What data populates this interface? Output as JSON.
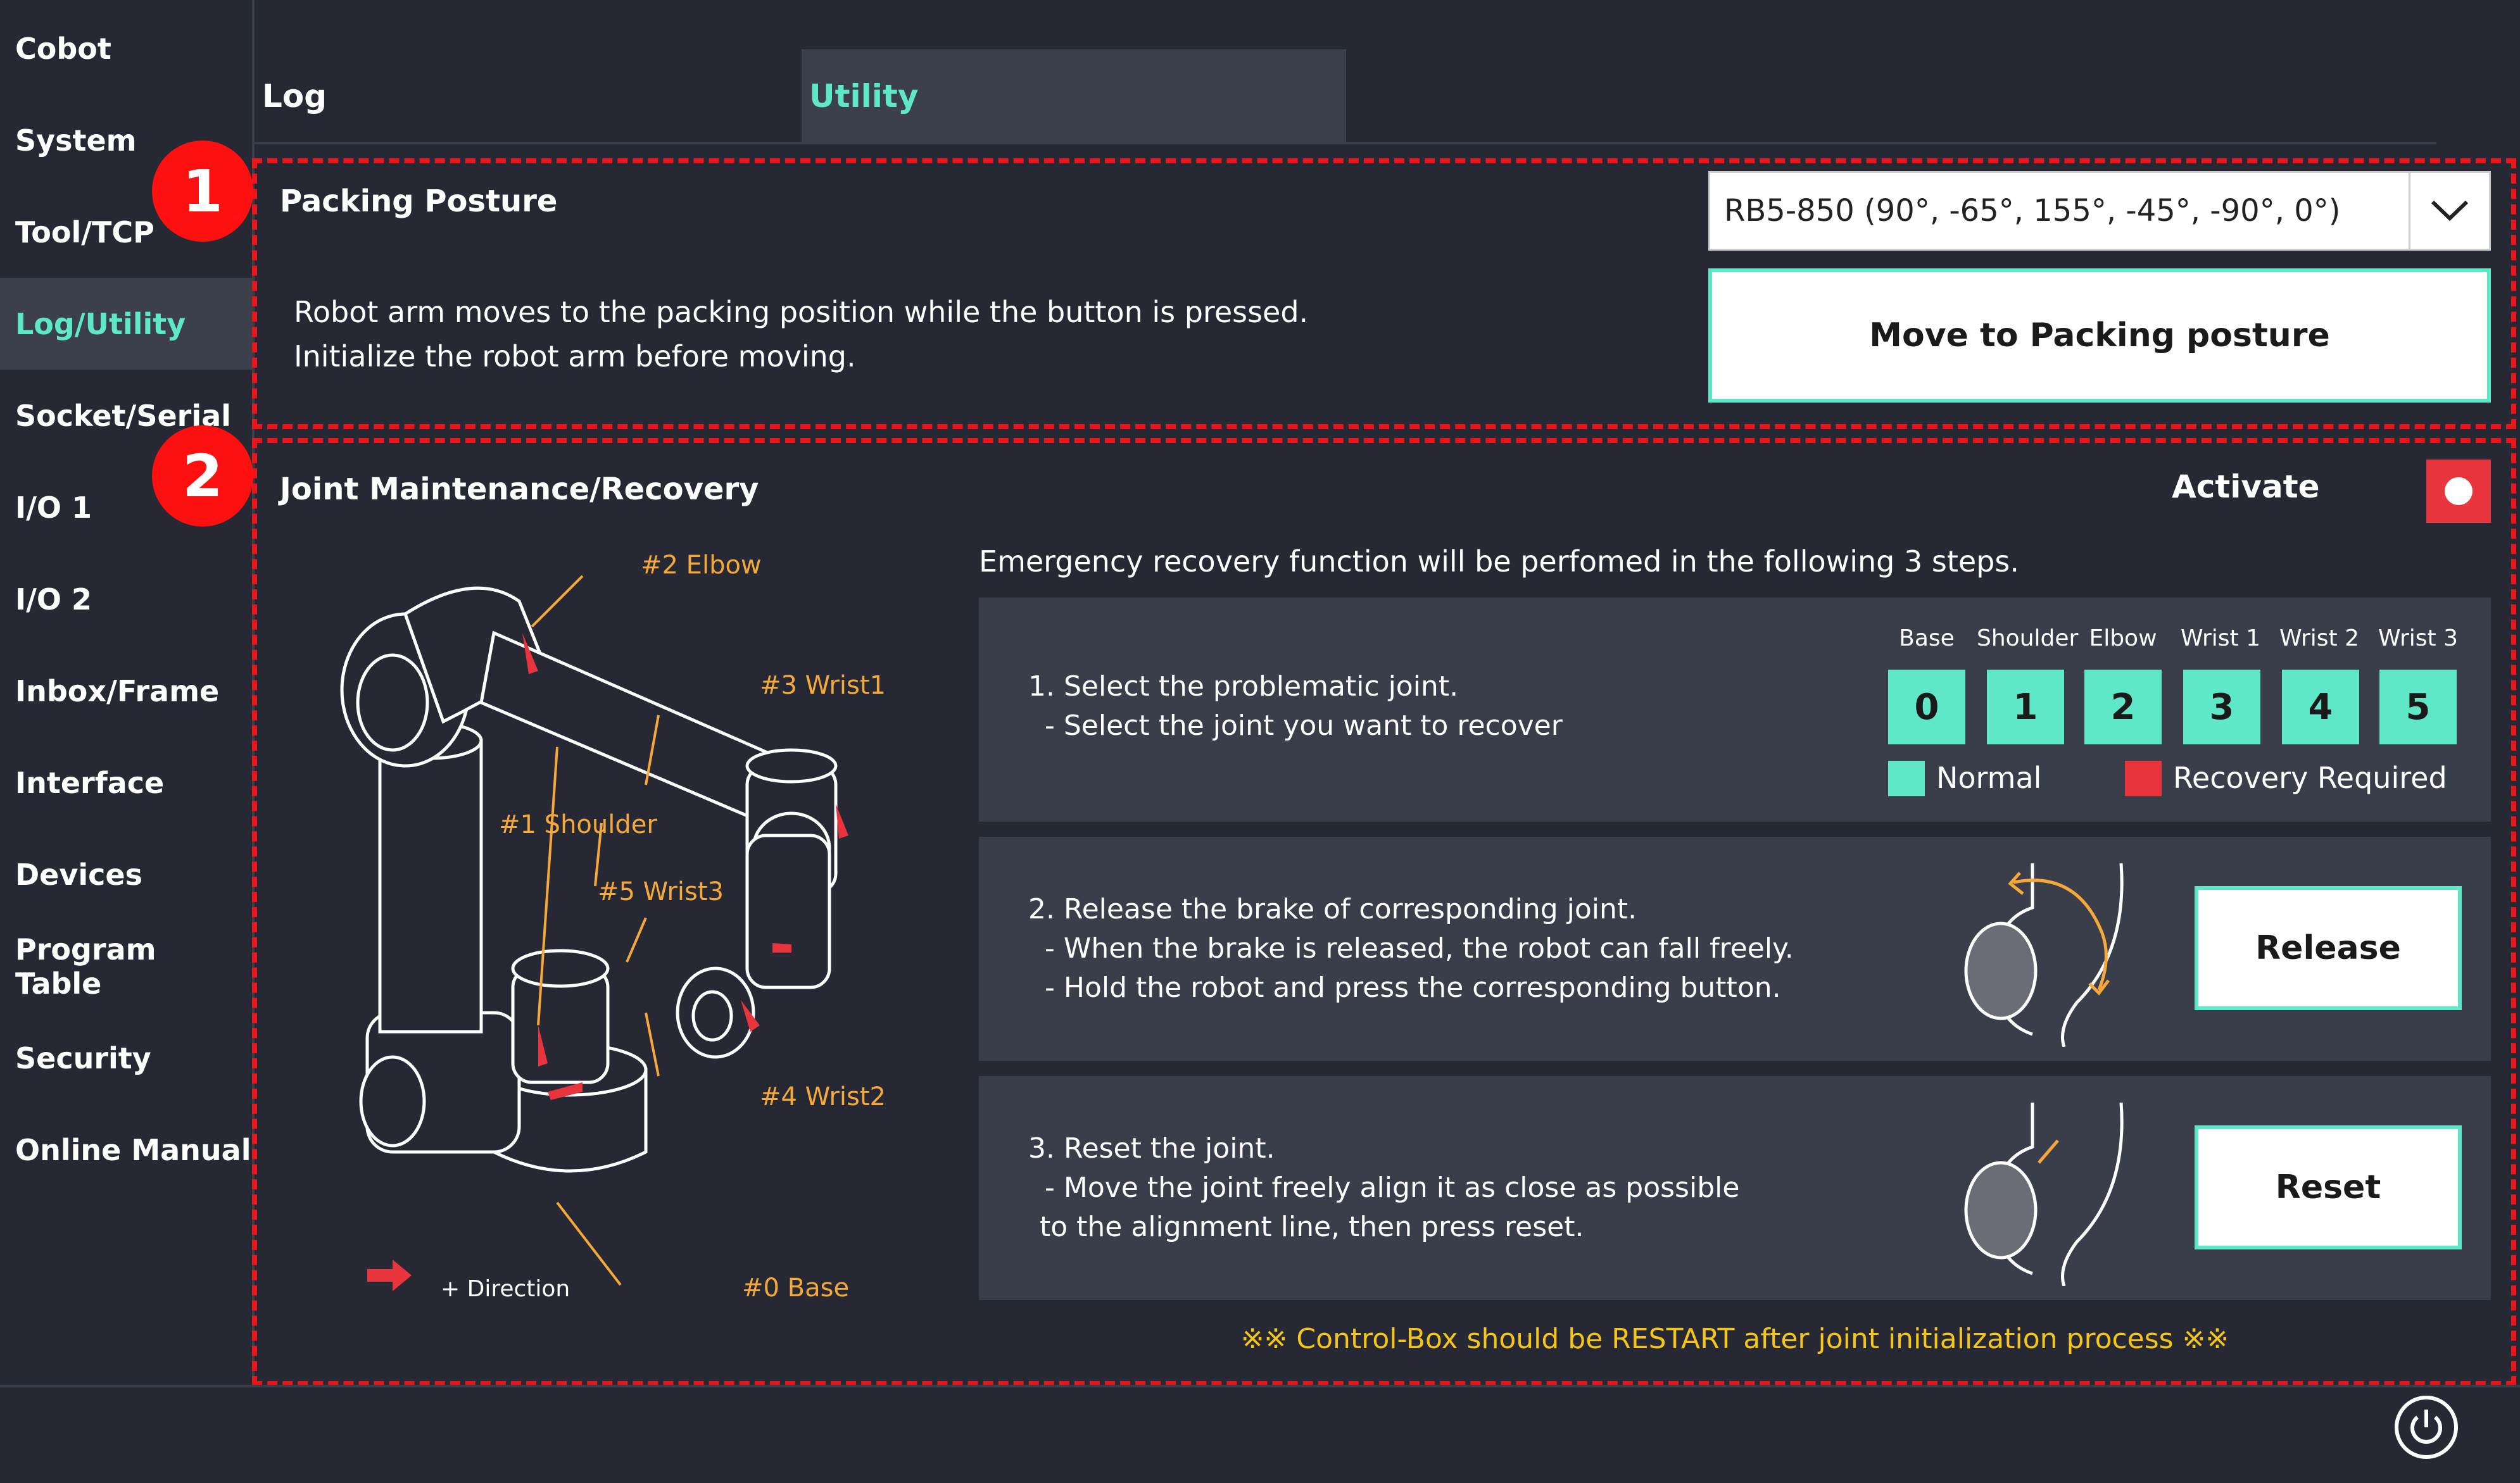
{
  "sidebar": {
    "items": [
      {
        "label": "Cobot"
      },
      {
        "label": "System"
      },
      {
        "label": "Tool/TCP"
      },
      {
        "label": "Log/Utility",
        "active": true
      },
      {
        "label": "Socket/Serial"
      },
      {
        "label": "I/O 1"
      },
      {
        "label": "I/O 2"
      },
      {
        "label": "Inbox/Frame"
      },
      {
        "label": "Interface"
      },
      {
        "label": "Devices"
      },
      {
        "label": "Program Table"
      },
      {
        "label": "Security"
      },
      {
        "label": "Online Manual"
      }
    ]
  },
  "tabs": [
    {
      "label": "Log",
      "active": false
    },
    {
      "label": "Utility",
      "active": true
    }
  ],
  "badges": {
    "one": "1",
    "two": "2"
  },
  "packing": {
    "title": "Packing Posture",
    "description_line1": "Robot arm moves to the packing position while the button is pressed.",
    "description_line2": "Initialize the robot arm before moving.",
    "posture_selected": "RB5-850 (90°, -65°, 155°, -45°, -90°, 0°)",
    "move_button": "Move to Packing posture"
  },
  "joint": {
    "title": "Joint Maintenance/Recovery",
    "activate_label": "Activate",
    "intro": "Emergency recovery function will be perfomed in the following 3 steps.",
    "step1": {
      "line1": "1. Select the problematic joint.",
      "line2": "- Select the joint you want to recover"
    },
    "joint_headers": [
      "Base",
      "Shoulder",
      "Elbow",
      "Wrist 1",
      "Wrist 2",
      "Wrist 3"
    ],
    "joint_buttons": [
      "0",
      "1",
      "2",
      "3",
      "4",
      "5"
    ],
    "legend": {
      "normal": "Normal",
      "recovery": "Recovery Required"
    },
    "step2": {
      "line1": "2. Release the brake of corresponding joint.",
      "line2": "- When the brake is released, the robot can fall freely.",
      "line3": "- Hold the robot and press the corresponding button.",
      "button": "Release"
    },
    "step3": {
      "line1": "3. Reset the joint.",
      "line2": "- Move the joint freely align it as close as possible",
      "line3": "to the alignment line, then press reset.",
      "button": "Reset"
    },
    "restart_note": "※※ Control-Box should be RESTART after joint initialization process ※※"
  },
  "diagram": {
    "labels": {
      "elbow": "#2 Elbow",
      "wrist1": "#3 Wrist1",
      "shoulder": "#1 Shoulder",
      "wrist3": "#5 Wrist3",
      "wrist2": "#4 Wrist2",
      "base": "#0 Base",
      "direction": "+ Direction"
    }
  },
  "colors": {
    "background": "#262933",
    "panel": "#3a3e4a",
    "accent": "#5ee8c8",
    "recovery": "#e8343c",
    "highlight_dash": "#e8151b",
    "callout": "#f6a93b",
    "warning": "#f5c518"
  },
  "icons": {
    "dropdown": "chevron-down-icon",
    "power": "power-icon",
    "toggle": "record-dot-icon"
  }
}
